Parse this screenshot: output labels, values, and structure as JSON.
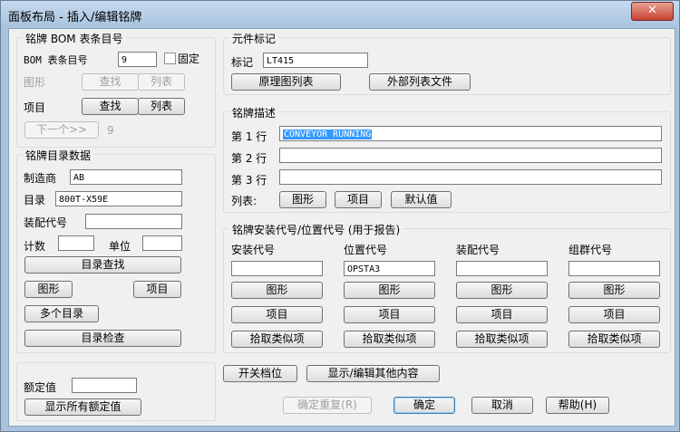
{
  "window": {
    "title": "面板布局 - 插入/编辑铭牌",
    "close_glyph": "✕"
  },
  "bom": {
    "group_title": "铭牌 BOM 表条目号",
    "item_label": "BOM 表条目号",
    "item_value": "9",
    "fixed_label": "固定",
    "graphic_label": "图形",
    "find_label": "查找",
    "list_label": "列表",
    "project_label": "项目",
    "next_label": "下一个>>",
    "next_value": "9"
  },
  "catalog": {
    "group_title": "铭牌目录数据",
    "manufacturer_label": "制造商",
    "manufacturer_value": "AB",
    "catalog_label": "目录",
    "catalog_value": "800T-X59E",
    "assembly_label": "装配代号",
    "count_label": "计数",
    "unit_label": "单位",
    "lookup_label": "目录查找",
    "graphic_label": "图形",
    "project_label": "项目",
    "multi_label": "多个目录",
    "check_label": "目录检查"
  },
  "rating": {
    "label": "额定值",
    "show_all_label": "显示所有额定值"
  },
  "tag": {
    "group_title": "元件标记",
    "label": "标记",
    "value": "LT415",
    "schematic_list_label": "原理图列表",
    "external_list_label": "外部列表文件"
  },
  "desc": {
    "group_title": "铭牌描述",
    "line1_label": "第 1 行",
    "line1_value": "CONVEYOR RUNNING",
    "line2_label": "第 2 行",
    "line3_label": "第 3 行",
    "list_label": "列表:",
    "graphic_label": "图形",
    "project_label": "项目",
    "default_label": "默认值"
  },
  "location": {
    "group_title": "铭牌安装代号/位置代号 (用于报告)",
    "columns": [
      {
        "header": "安装代号",
        "value": ""
      },
      {
        "header": "位置代号",
        "value": "OPSTA3"
      },
      {
        "header": "装配代号",
        "value": ""
      },
      {
        "header": "组群代号",
        "value": ""
      }
    ],
    "graphic_label": "图形",
    "project_label": "项目",
    "pick_label": "拾取类似项"
  },
  "footer": {
    "switch_pos_label": "开关档位",
    "show_edit_label": "显示/编辑其他内容",
    "ok_repeat_label": "确定重复(R)",
    "ok_label": "确定",
    "cancel_label": "取消",
    "help_label": "帮助(H)"
  }
}
